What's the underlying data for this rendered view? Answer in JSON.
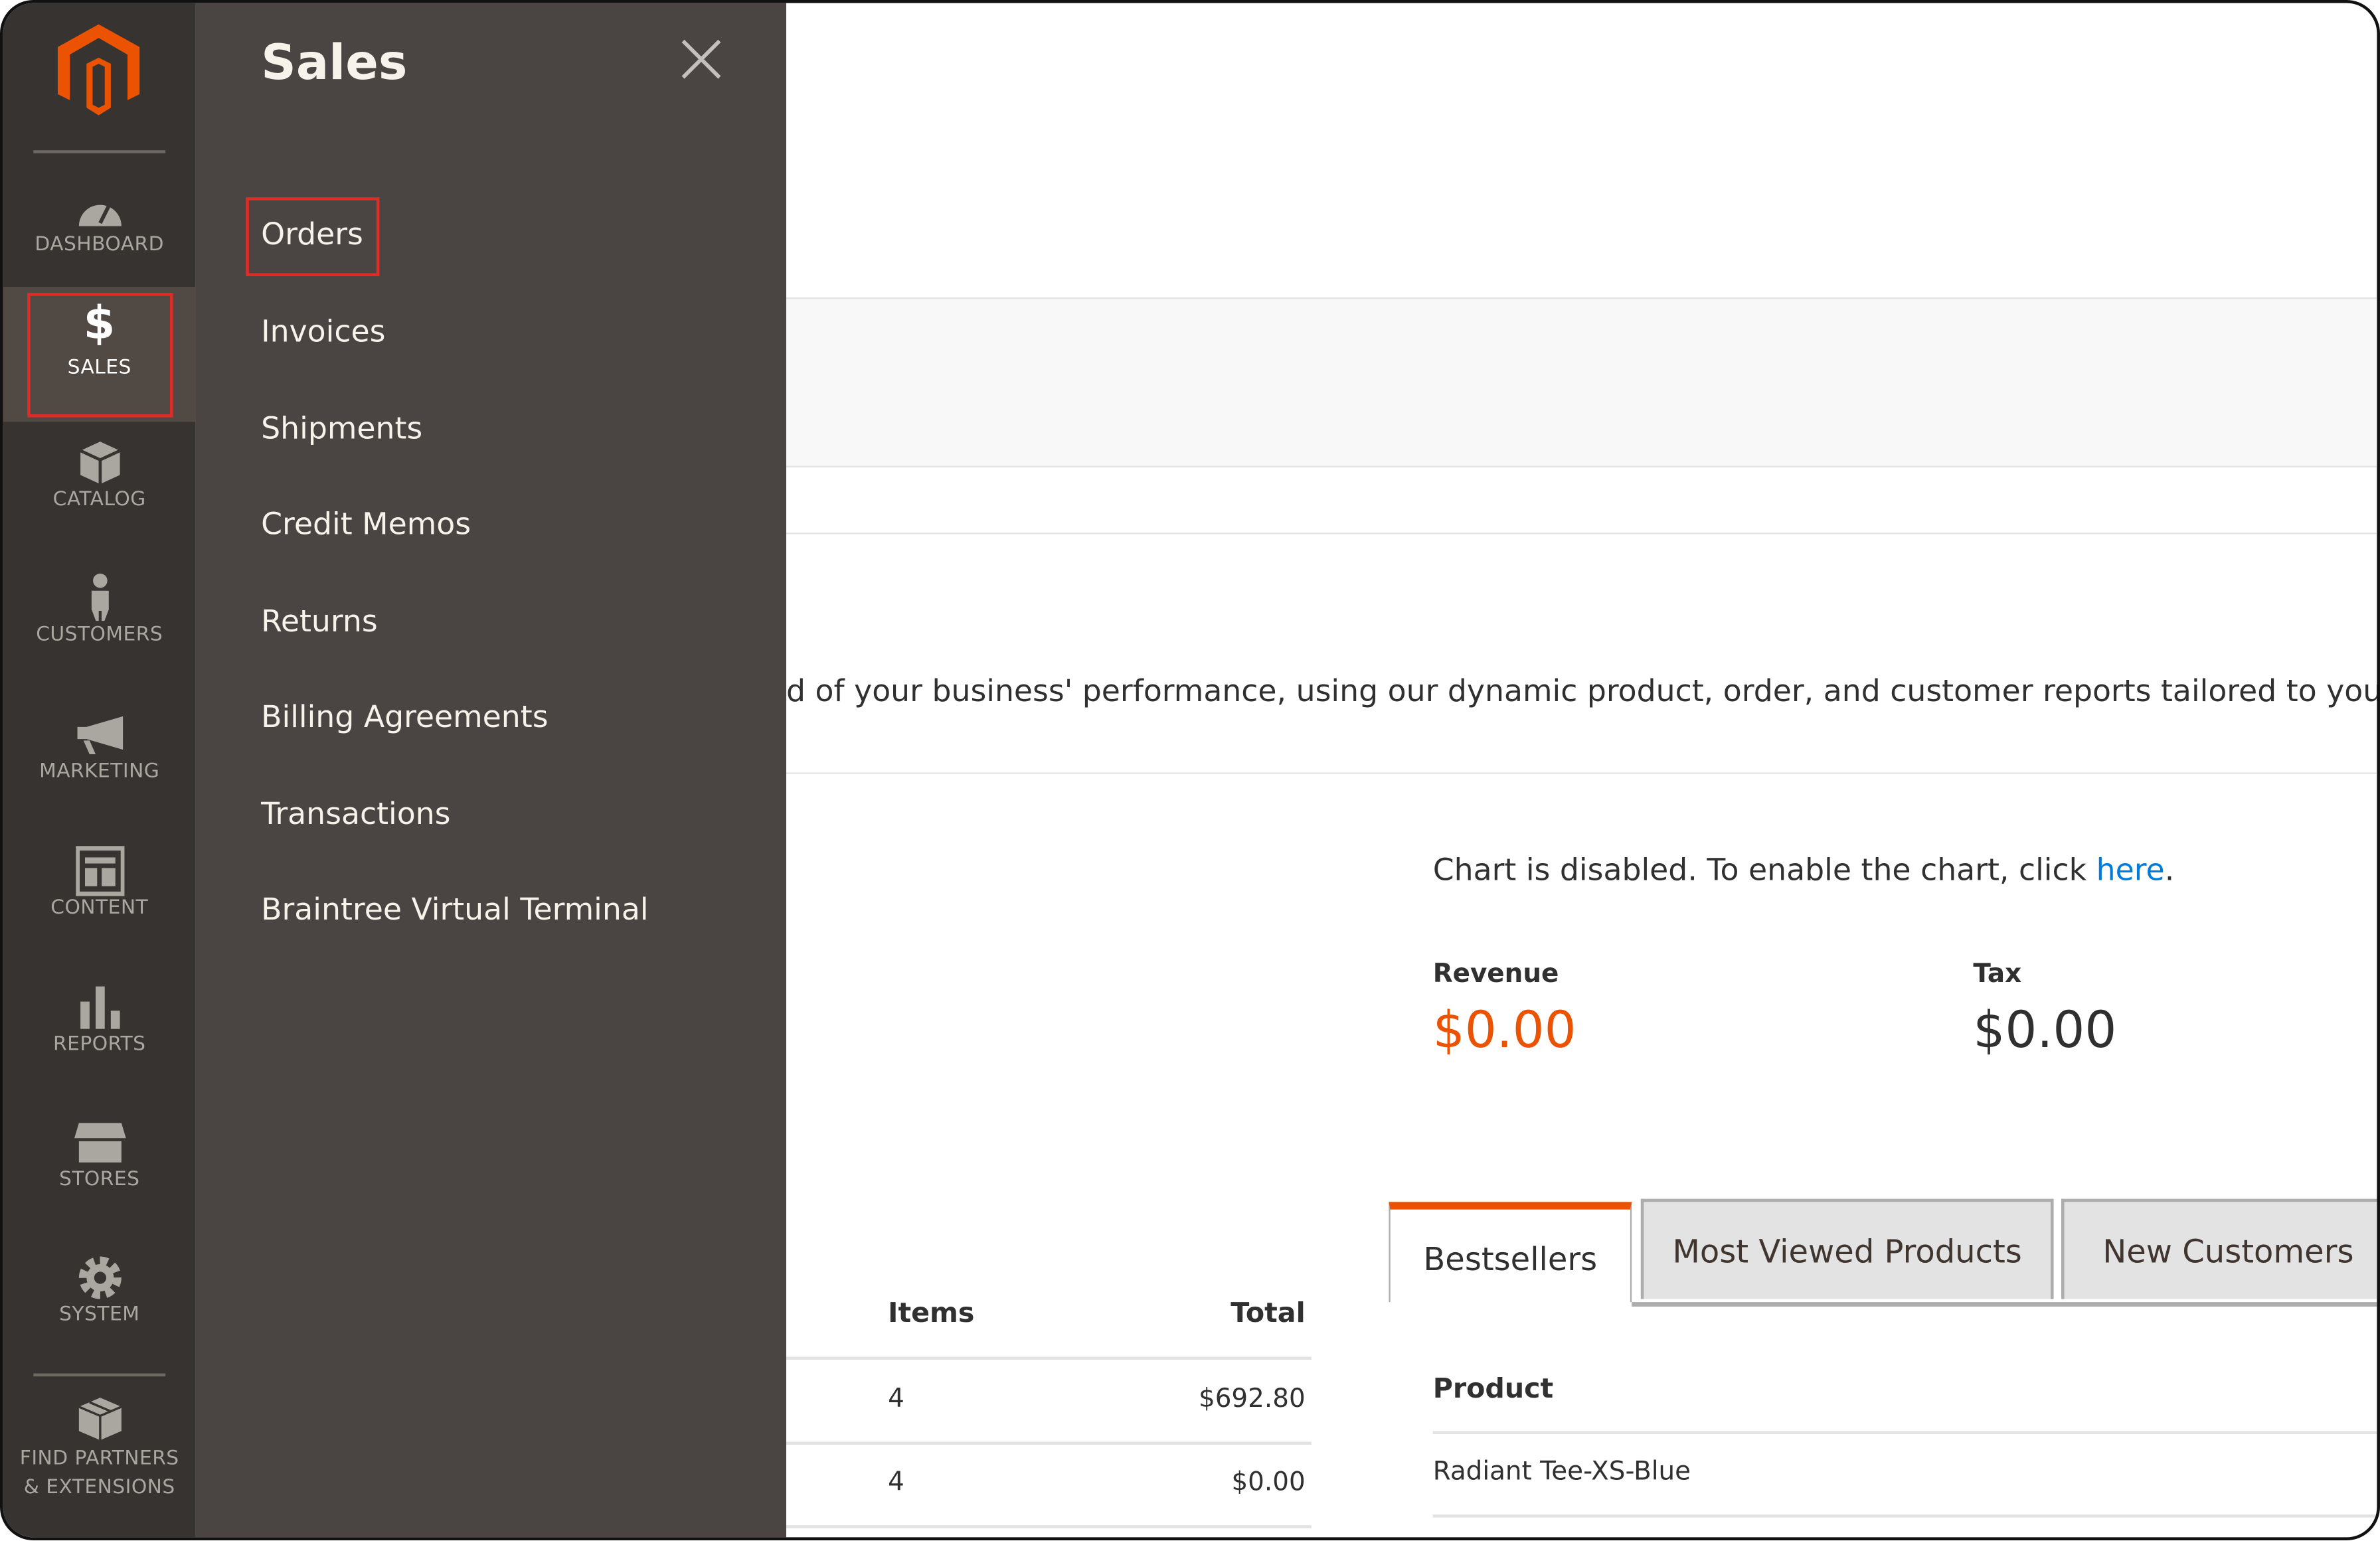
{
  "sidebar": {
    "items": [
      {
        "label": "DASHBOARD",
        "icon": "dashboard-icon"
      },
      {
        "label": "SALES",
        "icon": "dollar-icon",
        "active": true
      },
      {
        "label": "CATALOG",
        "icon": "box-icon"
      },
      {
        "label": "CUSTOMERS",
        "icon": "person-icon"
      },
      {
        "label": "MARKETING",
        "icon": "megaphone-icon"
      },
      {
        "label": "CONTENT",
        "icon": "layout-icon"
      },
      {
        "label": "REPORTS",
        "icon": "bar-chart-icon"
      },
      {
        "label": "STORES",
        "icon": "store-icon"
      },
      {
        "label": "SYSTEM",
        "icon": "gear-icon"
      },
      {
        "label": "FIND PARTNERS & EXTENSIONS",
        "icon": "cubes-icon"
      }
    ]
  },
  "flyout": {
    "title": "Sales",
    "items": [
      "Orders",
      "Invoices",
      "Shipments",
      "Credit Memos",
      "Returns",
      "Billing Agreements",
      "Transactions",
      "Braintree Virtual Terminal"
    ]
  },
  "main": {
    "intro": "d of your business' performance, using our dynamic product, order, and customer reports tailored to your custo",
    "chart_notice": "Chart is disabled. To enable the chart, click ",
    "chart_link": "here",
    "chart_notice_end": ".",
    "revenue_label": "Revenue",
    "revenue_value": "$0.00",
    "tax_label": "Tax",
    "tax_value": "$0.00",
    "orders_table": {
      "headers": [
        "Items",
        "Total"
      ],
      "rows": [
        [
          "4",
          "$692.80"
        ],
        [
          "4",
          "$0.00"
        ]
      ]
    },
    "tabs": [
      "Bestsellers",
      "Most Viewed Products",
      "New Customers"
    ],
    "product_header": "Product",
    "products": [
      "Radiant Tee-XS-Blue"
    ]
  },
  "colors": {
    "accent": "#eb5202",
    "link": "#007bdb",
    "nav_bg": "#373330",
    "flyout_bg": "#4a4542",
    "highlight": "#e02b27"
  }
}
